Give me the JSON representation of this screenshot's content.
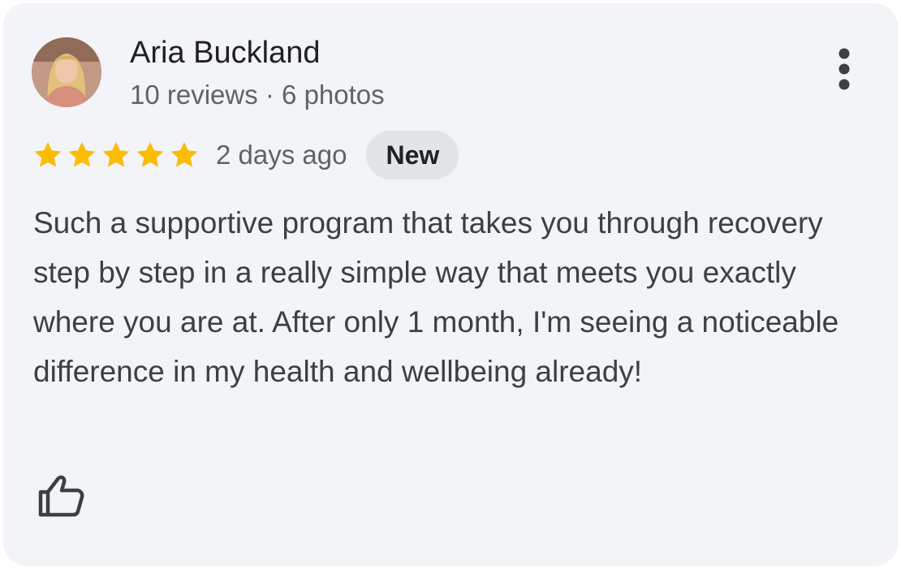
{
  "review": {
    "author": {
      "name": "Aria Buckland",
      "meta": "10 reviews · 6 photos",
      "avatar_icon": "profile-photo"
    },
    "rating": 5,
    "rating_max": 5,
    "date": "2 days ago",
    "badge": "New",
    "text": "Such a supportive program that takes you through recovery step by step in a really simple way that meets you exactly where you are at. After only 1 month, I'm seeing a noticeable difference in my health and wellbeing already!"
  },
  "icons": {
    "more": "more-vert-icon",
    "star": "star-icon",
    "like": "thumbs-up-icon"
  },
  "colors": {
    "card_bg": "#f2f4f7",
    "star": "#fbbc04",
    "badge_bg": "#e1e4e8",
    "secondary_text": "#5f6368",
    "body_text": "#3c4043"
  }
}
